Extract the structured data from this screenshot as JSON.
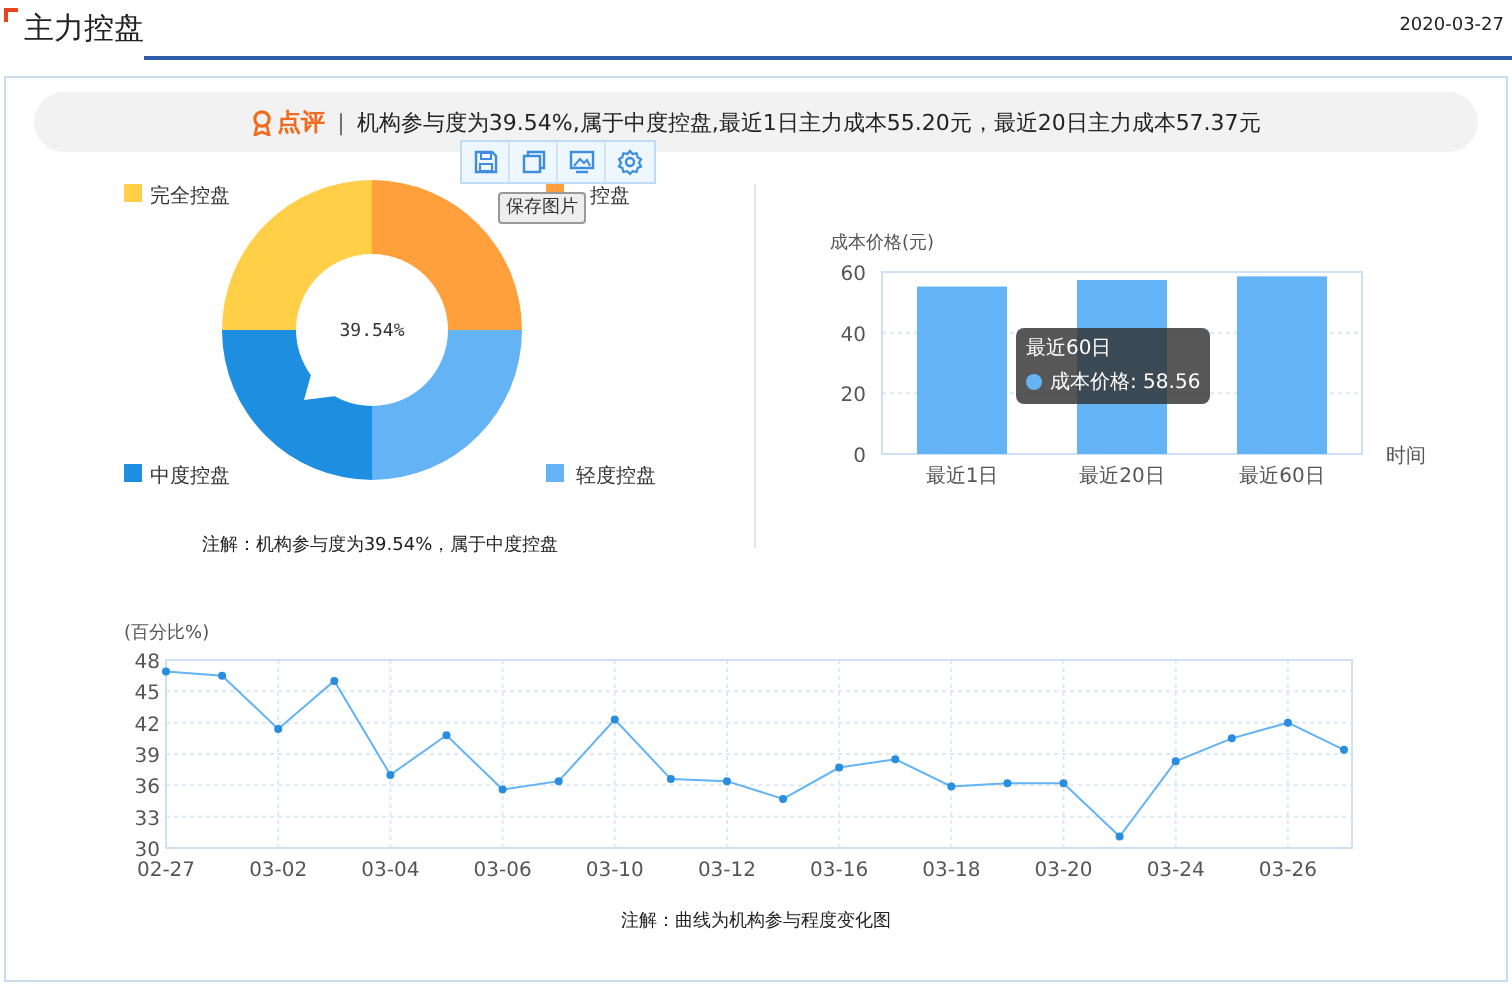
{
  "header": {
    "title": "主力控盘",
    "date": "2020-03-27"
  },
  "comment": {
    "label": "点评",
    "separator": "|",
    "text": "机构参与度为39.54%,属于中度控盘,最近1日主力成本55.20元，最近20日主力成本57.37元"
  },
  "donut": {
    "center_label": "39.54%",
    "legend": [
      {
        "label": "完全控盘",
        "color": "#ffcf48"
      },
      {
        "label": "控盘",
        "color": "#ffa03d"
      },
      {
        "label": "中度控盘",
        "color": "#1e8fe0"
      },
      {
        "label": "轻度控盘",
        "color": "#63b3f5"
      }
    ],
    "toolbar_tooltip": "保存图片",
    "note": "注解：机构参与度为39.54%，属于中度控盘"
  },
  "cost_chart": {
    "chart_data": {
      "type": "bar",
      "ylabel": "成本价格(元)",
      "xlabel": "时间",
      "categories": [
        "最近1日",
        "最近20日",
        "最近60日"
      ],
      "series": [
        {
          "color": "#63b3f5",
          "values": [
            55.2,
            57.37,
            58.56
          ]
        }
      ],
      "ylim": [
        0,
        60
      ],
      "yticks": [
        0,
        20,
        40,
        60
      ],
      "grid": true
    },
    "tooltip": {
      "title": "最近60日",
      "label": "成本价格: 58.56"
    }
  },
  "trend_chart": {
    "chart_data": {
      "type": "line",
      "ylabel": "(百分比%)",
      "categories": [
        "02-27",
        null,
        "03-02",
        null,
        "03-04",
        null,
        "03-06",
        null,
        "03-10",
        null,
        "03-12",
        null,
        "03-16",
        null,
        "03-18",
        null,
        "03-20",
        null,
        "03-24",
        null,
        "03-26",
        null
      ],
      "series": [
        {
          "color": "#63b3f5",
          "marker": "circle",
          "values": [
            46.9,
            46.5,
            41.4,
            46.0,
            37.0,
            40.8,
            35.6,
            36.4,
            42.3,
            36.6,
            36.4,
            34.7,
            37.7,
            38.5,
            35.9,
            36.2,
            36.2,
            31.1,
            38.3,
            40.5,
            42.0,
            39.4
          ]
        }
      ],
      "ylim": [
        30,
        48
      ],
      "yticks": [
        30,
        33,
        36,
        39,
        42,
        45,
        48
      ],
      "grid": true
    },
    "note": "注解：曲线为机构参与程度变化图"
  }
}
